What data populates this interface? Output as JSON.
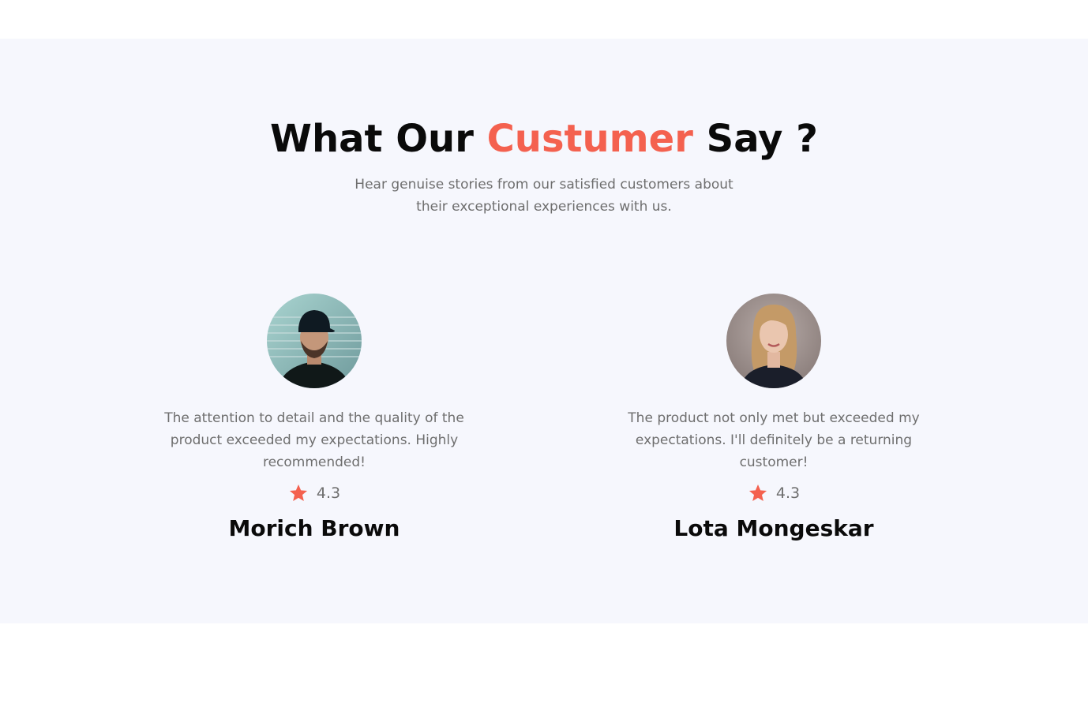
{
  "testimonials_section": {
    "heading": {
      "prefix": "What Our ",
      "highlight": "Custumer",
      "suffix": " Say ?"
    },
    "subtitle": "Hear genuise stories from our satisfied customers about their exceptional experiences with us.",
    "accent_color": "#f4614f",
    "background_color": "#f6f7fd",
    "reviews": [
      {
        "quote": "The attention to detail and the quality of the product exceeded my expectations. Highly recommended!",
        "rating_icon": "star-icon",
        "rating": "4.3",
        "name": "Morich Brown"
      },
      {
        "quote": "The product not only met but exceeded my expectations. I'll definitely be a returning customer!",
        "rating_icon": "star-icon",
        "rating": "4.3",
        "name": "Lota Mongeskar"
      }
    ]
  }
}
